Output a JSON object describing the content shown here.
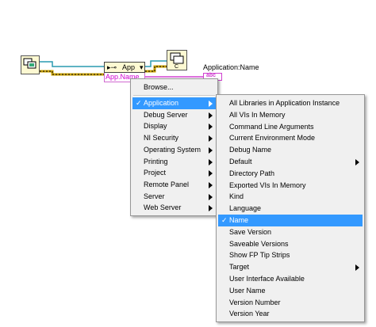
{
  "diagram": {
    "property_node_class": "App",
    "property_item": "App.Name",
    "indicator_label": "Application:Name",
    "indicator_type": "abc",
    "wire_colors": {
      "refnum": "#2a9ab0",
      "string": "#d040d0",
      "error": "#c8a000"
    }
  },
  "menu1": {
    "browse": "Browse...",
    "items": [
      {
        "label": "Application",
        "checked": true,
        "submenu": true,
        "selected": true
      },
      {
        "label": "Debug Server",
        "submenu": true
      },
      {
        "label": "Display",
        "submenu": true
      },
      {
        "label": "NI Security",
        "submenu": true
      },
      {
        "label": "Operating System",
        "submenu": true
      },
      {
        "label": "Printing",
        "submenu": true
      },
      {
        "label": "Project",
        "submenu": true
      },
      {
        "label": "Remote Panel",
        "submenu": true
      },
      {
        "label": "Server",
        "submenu": true
      },
      {
        "label": "Web Server",
        "submenu": true
      }
    ]
  },
  "menu2": {
    "items": [
      {
        "label": "All Libraries in Application Instance"
      },
      {
        "label": "All VIs In Memory"
      },
      {
        "label": "Command Line Arguments"
      },
      {
        "label": "Current Environment Mode"
      },
      {
        "label": "Debug Name"
      },
      {
        "label": "Default",
        "submenu": true
      },
      {
        "label": "Directory Path"
      },
      {
        "label": "Exported VIs In Memory"
      },
      {
        "label": "Kind"
      },
      {
        "label": "Language"
      },
      {
        "label": "Name",
        "checked": true,
        "selected": true
      },
      {
        "label": "Save Version"
      },
      {
        "label": "Saveable Versions"
      },
      {
        "label": "Show FP Tip Strips"
      },
      {
        "label": "Target",
        "submenu": true
      },
      {
        "label": "User Interface Available"
      },
      {
        "label": "User Name"
      },
      {
        "label": "Version Number"
      },
      {
        "label": "Version Year"
      }
    ]
  },
  "checkmark": "✓"
}
